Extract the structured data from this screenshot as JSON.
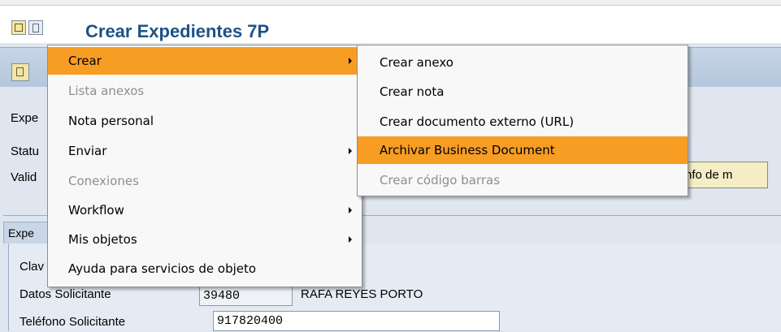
{
  "window": {
    "title": "Crear Expedientes 7P"
  },
  "icons": {
    "title_icon_1": "object-services-icon",
    "title_icon_2": "document-icon",
    "toolbar_back": "back-icon"
  },
  "form": {
    "label_exp": "Expe",
    "label_status": "Statu",
    "label_valid": "Valid",
    "info_button": "nfo de m",
    "group_tab": "Expe",
    "label_clave": "Clav",
    "label_datos_solicitante": "Datos Solicitante",
    "datos_solicitante_code": "39480",
    "datos_solicitante_name": "RAFA REYES PORTO",
    "label_telefono_solicitante": "Teléfono Solicitante",
    "telefono_solicitante": "917820400"
  },
  "menu": {
    "items": [
      {
        "label": "Crear",
        "submenu": true,
        "highlighted": true,
        "disabled": false
      },
      {
        "label": "Lista anexos",
        "submenu": false,
        "highlighted": false,
        "disabled": true
      },
      {
        "label": "Nota personal",
        "submenu": false,
        "highlighted": false,
        "disabled": false
      },
      {
        "label": "Enviar",
        "submenu": true,
        "highlighted": false,
        "disabled": false
      },
      {
        "label": "Conexiones",
        "submenu": false,
        "highlighted": false,
        "disabled": true
      },
      {
        "label": "Workflow",
        "submenu": true,
        "highlighted": false,
        "disabled": false
      },
      {
        "label": "Mis objetos",
        "submenu": true,
        "highlighted": false,
        "disabled": false
      },
      {
        "label": "Ayuda para servicios de objeto",
        "submenu": false,
        "highlighted": false,
        "disabled": false
      }
    ]
  },
  "submenu": {
    "items": [
      {
        "label": "Crear anexo",
        "highlighted": false,
        "disabled": false
      },
      {
        "label": "Crear nota",
        "highlighted": false,
        "disabled": false
      },
      {
        "label": "Crear documento externo (URL)",
        "highlighted": false,
        "disabled": false
      },
      {
        "label": "Archivar Business Document",
        "highlighted": true,
        "disabled": false
      },
      {
        "label": "Crear código barras",
        "highlighted": false,
        "disabled": true
      }
    ]
  },
  "colors": {
    "highlight": "#f79d24",
    "title": "#1d5288",
    "disabled_text": "#8e8e8e"
  }
}
